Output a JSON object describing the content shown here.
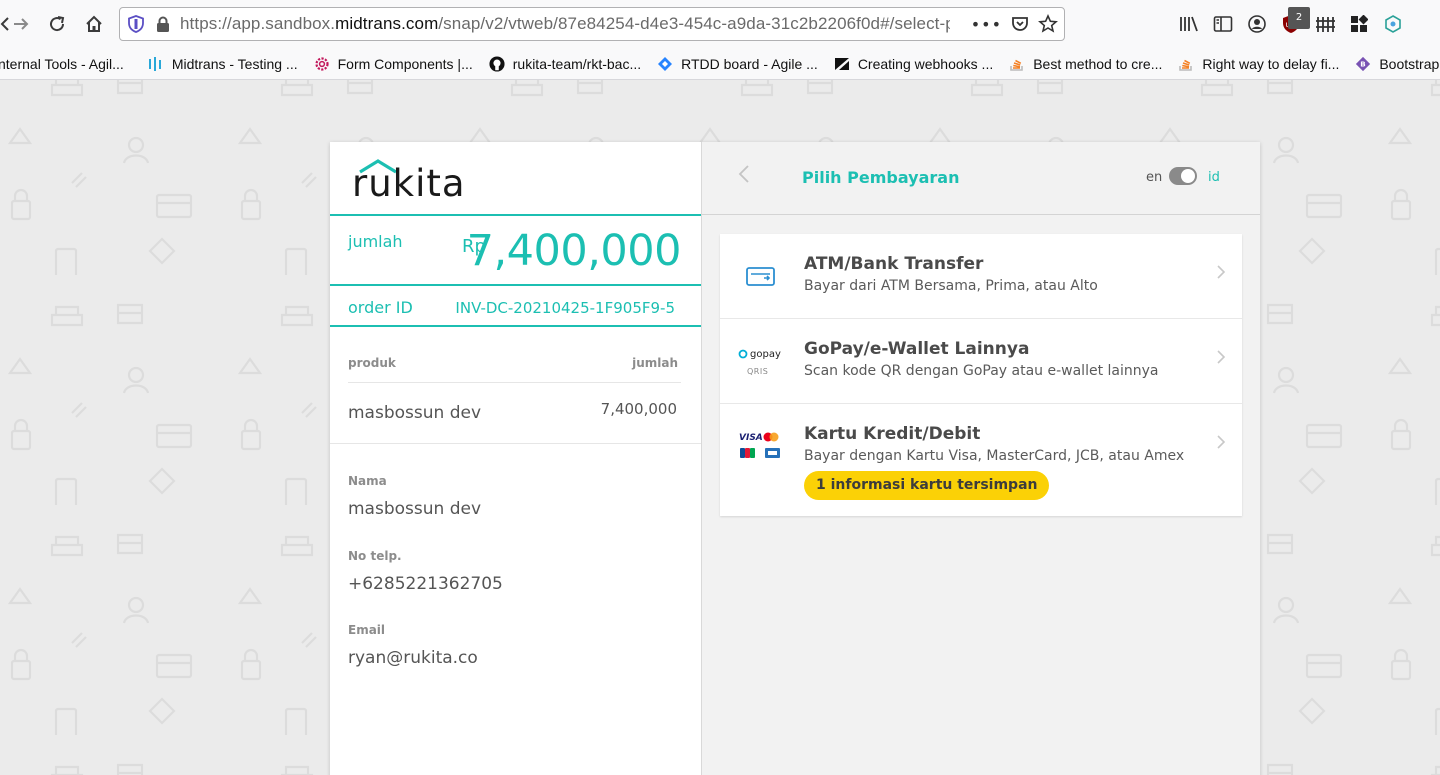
{
  "browser": {
    "url_prefix": "https://app.sandbox.",
    "url_domain": "midtrans.com",
    "url_path": "/snap/v2/vtweb/87e84254-d4e3-454c-a9da-31c2b2206f0d#/select-p",
    "badge_count": "2",
    "bookmarks": [
      {
        "label": "nternal Tools - Agil...",
        "icon": "jira-icon"
      },
      {
        "label": "Midtrans - Testing ...",
        "icon": "midtrans-icon"
      },
      {
        "label": "Form Components |...",
        "icon": "gear-icon"
      },
      {
        "label": "rukita-team/rkt-bac...",
        "icon": "github-icon"
      },
      {
        "label": "RTDD board - Agile ...",
        "icon": "diamond-icon"
      },
      {
        "label": "Creating webhooks ...",
        "icon": "zendesk-icon"
      },
      {
        "label": "Best method to cre...",
        "icon": "stackoverflow-icon"
      },
      {
        "label": "Right way to delay fi...",
        "icon": "stackoverflow-icon"
      },
      {
        "label": "Bootstrap Em",
        "icon": "bootstrap-icon"
      }
    ]
  },
  "merchant": {
    "logo_text": "rukita"
  },
  "summary": {
    "amount_label": "jumlah",
    "currency": "Rp",
    "amount": "7,400,000",
    "order_label": "order ID",
    "order_id": "INV-DC-20210425-1F905F9-5"
  },
  "products": {
    "col_product": "produk",
    "col_amount": "jumlah",
    "items": [
      {
        "name": "masbossun dev",
        "amount": "7,400,000"
      }
    ]
  },
  "customer": {
    "name_label": "Nama",
    "name": "masbossun dev",
    "phone_label": "No telp.",
    "phone": "+6285221362705",
    "email_label": "Email",
    "email": "ryan@rukita.co"
  },
  "payment": {
    "title": "Pilih Pembayaran",
    "lang_en": "en",
    "lang_id": "id",
    "methods": [
      {
        "title": "ATM/Bank Transfer",
        "subtitle": "Bayar dari ATM Bersama, Prima, atau Alto",
        "icon": "bank-card-icon"
      },
      {
        "title": "GoPay/e-Wallet Lainnya",
        "subtitle": "Scan kode QR dengan GoPay atau e-wallet lainnya",
        "icon": "gopay-qris-icon",
        "logo_gopay": "gopay",
        "logo_qris": "QRIS"
      },
      {
        "title": "Kartu Kredit/Debit",
        "subtitle": "Bayar dengan Kartu Visa, MasterCard, JCB, atau Amex",
        "icon": "card-brands-icon",
        "logo_visa": "VISA",
        "badge": "1 informasi kartu tersimpan"
      }
    ]
  },
  "colors": {
    "accent": "#1cbfb2",
    "badge": "#fbd106"
  }
}
